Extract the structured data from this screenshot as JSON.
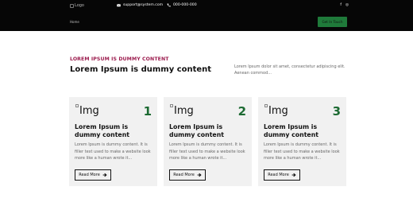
{
  "header": {
    "logo_alt": "Logo",
    "email": "support@system.com",
    "phone": "000-000-000",
    "social": [
      {
        "icon": "facebook-icon",
        "glyph": "f"
      },
      {
        "icon": "instagram-icon",
        "glyph": "◎"
      }
    ],
    "nav_home": "Home",
    "cta_label": "Get In Touch"
  },
  "hero": {
    "eyebrow": "LOREM IPSUM IS DUMMY CONTENT",
    "title": "Lorem Ipsum is dummy content",
    "description": "Lorem Ipsum dolor sit amet, consectetur adipiscing elit. Aenean commod..."
  },
  "cards": [
    {
      "img_alt": "Img",
      "number": "1",
      "title": "Lorem Ipsum is dummy content",
      "text": "Lorem Ipsum is dummy content. It is filler text used to make a website look more like a human wrote it...",
      "button": "Read More"
    },
    {
      "img_alt": "Img",
      "number": "2",
      "title": "Lorem Ipsum is dummy content",
      "text": "Lorem Ipsum is dummy content. It is filler text used to make a website look more like a human wrote it...",
      "button": "Read More"
    },
    {
      "img_alt": "Img",
      "number": "3",
      "title": "Lorem Ipsum is dummy content",
      "text": "Lorem Ipsum is dummy content. It is filler text used to make a website look more like a human wrote it...",
      "button": "Read More"
    }
  ],
  "colors": {
    "topbar": "#060606",
    "accent_green": "#1f7a3a",
    "eyebrow": "#9c1c4e",
    "card_bg": "#f1f1f1"
  }
}
